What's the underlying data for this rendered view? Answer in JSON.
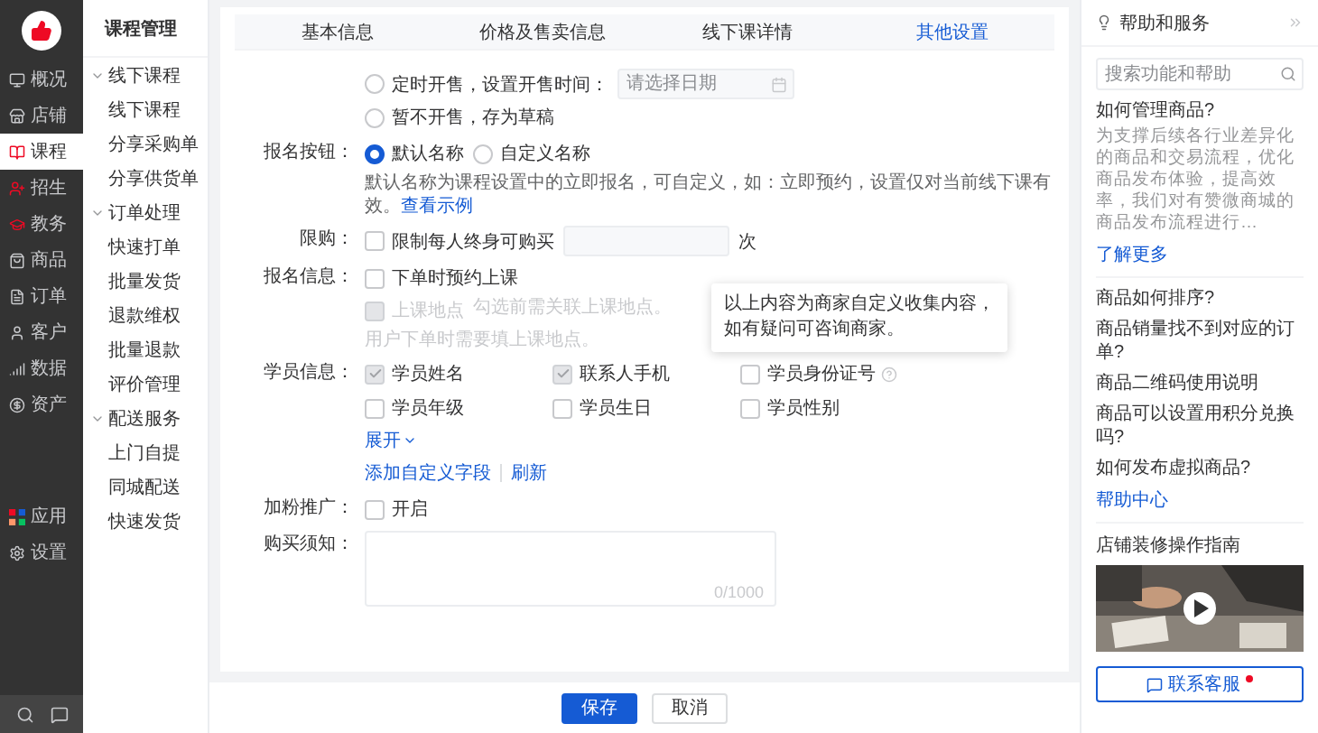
{
  "nav": {
    "items": [
      {
        "label": "概况",
        "selected": false
      },
      {
        "label": "店铺",
        "selected": false
      },
      {
        "label": "课程",
        "selected": true
      },
      {
        "label": "招生",
        "selected": false
      },
      {
        "label": "教务",
        "selected": false
      },
      {
        "label": "商品",
        "selected": false
      },
      {
        "label": "订单",
        "selected": false
      },
      {
        "label": "客户",
        "selected": false
      },
      {
        "label": "数据",
        "selected": false
      },
      {
        "label": "资产",
        "selected": false
      }
    ],
    "bottom_items": [
      {
        "label": "应用",
        "selected": false
      },
      {
        "label": "设置",
        "selected": false
      }
    ]
  },
  "course_menu": {
    "title": "课程管理",
    "groups": [
      {
        "label": "线下课程",
        "expanded": true,
        "children": [
          {
            "label": "线下课程"
          },
          {
            "label": "分享采购单"
          },
          {
            "label": "分享供货单"
          }
        ]
      },
      {
        "label": "订单处理",
        "expanded": true,
        "children": [
          {
            "label": "快速打单"
          },
          {
            "label": "批量发货"
          },
          {
            "label": "退款维权"
          },
          {
            "label": "批量退款"
          },
          {
            "label": "评价管理"
          }
        ]
      },
      {
        "label": "配送服务",
        "expanded": true,
        "children": [
          {
            "label": "上门自提"
          },
          {
            "label": "同城配送"
          },
          {
            "label": "快速发货"
          }
        ]
      }
    ]
  },
  "tabs": [
    {
      "label": "基本信息",
      "selected": false
    },
    {
      "label": "价格及售卖信息",
      "selected": false
    },
    {
      "label": "线下课详情",
      "selected": false
    },
    {
      "label": "其他设置",
      "selected": true
    }
  ],
  "sale": {
    "options": [
      {
        "label": "定时开售，设置开售时间：",
        "selected": false,
        "date_placeholder": "请选择日期"
      },
      {
        "label": "暂不开售，存为草稿",
        "selected": false
      }
    ]
  },
  "signup_button": {
    "label": "报名按钮：",
    "options": [
      {
        "label": "默认名称",
        "selected": true
      },
      {
        "label": "自定义名称",
        "selected": false
      }
    ],
    "hint": "默认名称为课程设置中的立即报名，可自定义，如：立即预约，设置仅对当前线下课有效。",
    "hint_link": "查看示例"
  },
  "limit": {
    "label": "限购：",
    "checkbox": {
      "label": "限制每人终身可购买",
      "checked": false
    },
    "unit": "次"
  },
  "signup_info": {
    "label": "报名信息：",
    "options": [
      {
        "label": "下单时预约上课",
        "checked": false,
        "disabled": false
      },
      {
        "label": "上课地点",
        "checked": false,
        "disabled": true,
        "note": "勾选前需关联上课地点。"
      }
    ],
    "hint": "用户下单时需要填上课地点。"
  },
  "student_info": {
    "label": "学员信息：",
    "fields": [
      {
        "label": "学员姓名",
        "checked": true,
        "disabled": true
      },
      {
        "label": "联系人手机",
        "checked": true,
        "disabled": true
      },
      {
        "label": "学员身份证号",
        "checked": false,
        "disabled": false,
        "help": true
      },
      {
        "label": "学员年级",
        "checked": false,
        "disabled": false
      },
      {
        "label": "学员生日",
        "checked": false,
        "disabled": false
      },
      {
        "label": "学员性别",
        "checked": false,
        "disabled": false
      }
    ],
    "expand": "展开",
    "actions": [
      "添加自定义字段",
      "刷新"
    ]
  },
  "tooltip": {
    "text": "以上内容为商家自定义收集内容，如有疑问可咨询商家。"
  },
  "promotion": {
    "label": "加粉推广：",
    "checkbox": {
      "label": "开启",
      "checked": false
    }
  },
  "notice": {
    "label": "购买须知：",
    "counter": "0/1000"
  },
  "footer": {
    "buttons": [
      {
        "label": "保存",
        "kind": "primary"
      },
      {
        "label": "取消",
        "kind": "default"
      }
    ]
  },
  "help_panel": {
    "title": "帮助和服务",
    "search_placeholder": "搜索功能和帮助",
    "article": {
      "title": "如何管理商品?",
      "summary": "为支撑后续各行业差异化的商品和交易流程，优化商品发布体验，提高效率，我们对有赞微商城的商品发布流程进行…",
      "link": "了解更多"
    },
    "questions": [
      "商品如何排序?",
      "商品销量找不到对应的订单?",
      "商品二维码使用说明",
      "商品可以设置用积分兑换吗?",
      "如何发布虚拟商品?"
    ],
    "help_link": "帮助中心",
    "guide": {
      "title": "店铺装修操作指南"
    },
    "contact": {
      "label": "联系客服",
      "unread": true
    }
  }
}
